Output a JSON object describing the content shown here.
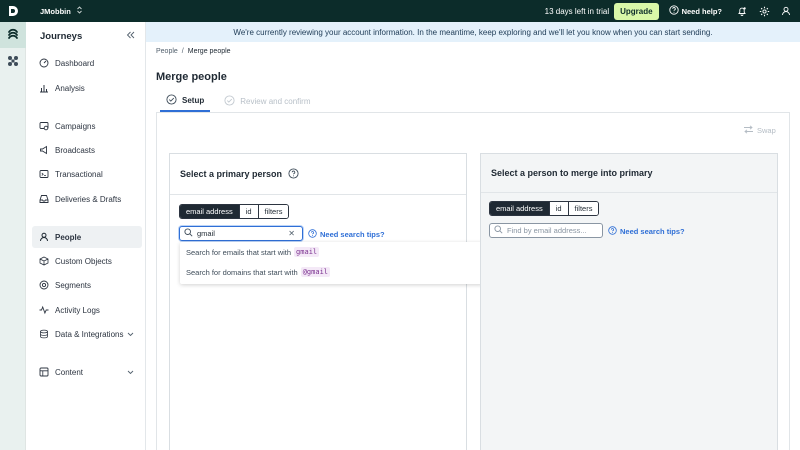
{
  "topbar": {
    "workspace": "JMobbin",
    "trial_text": "13 days left in trial",
    "upgrade_label": "Upgrade",
    "help_label": "Need help?",
    "colors": {
      "bg": "#0c2c2a",
      "upgrade_bg": "#d8f7a8"
    }
  },
  "rail": {
    "items": [
      {
        "icon": "journeys-logo-icon"
      },
      {
        "icon": "integrations-x-icon"
      }
    ]
  },
  "sidebar": {
    "title": "Journeys",
    "items": [
      {
        "label": "Dashboard",
        "icon": "dashboard-icon"
      },
      {
        "label": "Analysis",
        "icon": "bar-chart-icon"
      },
      {
        "label": "Campaigns",
        "icon": "campaigns-icon"
      },
      {
        "label": "Broadcasts",
        "icon": "megaphone-icon"
      },
      {
        "label": "Transactional",
        "icon": "terminal-icon"
      },
      {
        "label": "Deliveries & Drafts",
        "icon": "inbox-icon"
      },
      {
        "label": "People",
        "icon": "person-icon"
      },
      {
        "label": "Custom Objects",
        "icon": "cube-icon"
      },
      {
        "label": "Segments",
        "icon": "segments-icon"
      },
      {
        "label": "Activity Logs",
        "icon": "activity-icon"
      },
      {
        "label": "Data & Integrations",
        "icon": "database-icon"
      },
      {
        "label": "Content",
        "icon": "content-icon"
      }
    ]
  },
  "banner": {
    "text": "We're currently reviewing your account information. In the meantime, keep exploring and we'll let you know when you can start sending."
  },
  "breadcrumb": {
    "parent": "People",
    "separator": "/",
    "current": "Merge people"
  },
  "page": {
    "title": "Merge people"
  },
  "steps": [
    {
      "label": "Setup",
      "state": "active"
    },
    {
      "label": "Review and confirm",
      "state": "disabled"
    }
  ],
  "swap_label": "Swap",
  "primary": {
    "title": "Select a primary person",
    "tabs": [
      "email address",
      "id",
      "filters"
    ],
    "search_value": "gmail",
    "tips_label": "Need search tips?",
    "suggestions": [
      {
        "text": "Search for emails that start with",
        "code": "gmail"
      },
      {
        "text": "Search for domains that start with",
        "code": "@gmail"
      }
    ]
  },
  "secondary": {
    "title": "Select a person to merge into primary",
    "tabs": [
      "email address",
      "id",
      "filters"
    ],
    "search_placeholder": "Find by email address...",
    "tips_label": "Need search tips?"
  },
  "accent_color": "#2f6fd6"
}
